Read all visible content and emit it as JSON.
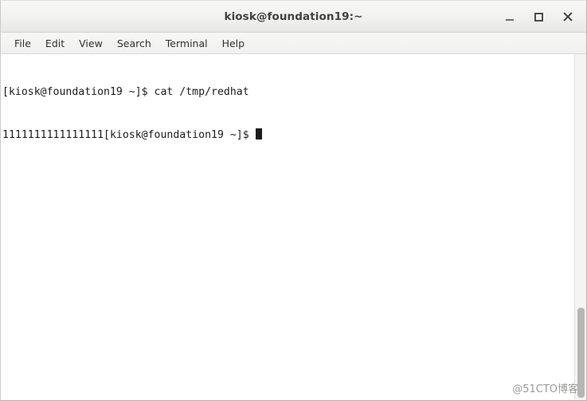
{
  "window": {
    "title": "kiosk@foundation19:~",
    "controls": [
      {
        "name": "minimize",
        "label": "–"
      },
      {
        "name": "maximize",
        "label": "□"
      },
      {
        "name": "close",
        "label": "×"
      }
    ]
  },
  "menubar": {
    "items": [
      {
        "label": "File"
      },
      {
        "label": "Edit"
      },
      {
        "label": "View"
      },
      {
        "label": "Search"
      },
      {
        "label": "Terminal"
      },
      {
        "label": "Help"
      }
    ]
  },
  "terminal": {
    "lines": [
      "[kiosk@foundation19 ~]$ cat /tmp/redhat",
      "1111111111111111[kiosk@foundation19 ~]$ "
    ],
    "prompt": "[kiosk@foundation19 ~]$",
    "command": "cat /tmp/redhat",
    "output": "1111111111111111",
    "cursor": "block",
    "fg_color": "#1b1b1b",
    "bg_color": "#ffffff"
  },
  "scrollbar": {
    "thumb_position": "bottom"
  },
  "watermark": {
    "text": "@51CTO博客"
  }
}
